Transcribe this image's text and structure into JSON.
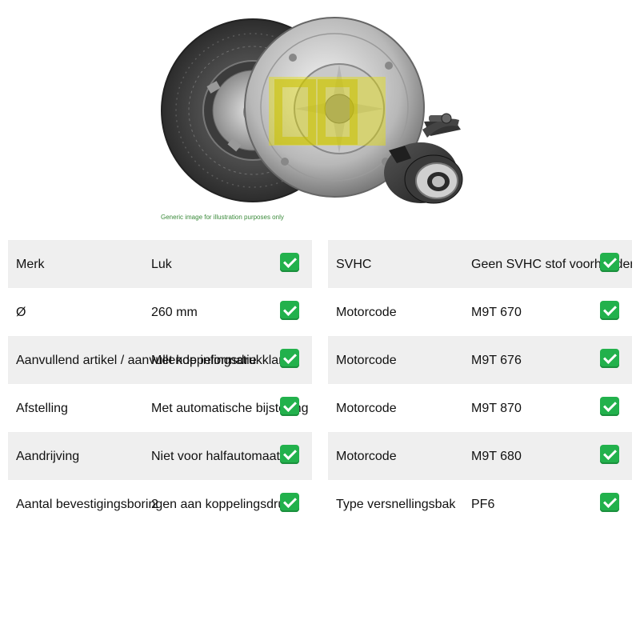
{
  "product_image": {
    "icon": "clutch-kit-photo",
    "brand_mark": "LUK",
    "caption": "Generic image for illustration purposes only"
  },
  "left_table": {
    "rows": [
      {
        "label": "Merk",
        "value": "Luk",
        "status_icon": "check-icon"
      },
      {
        "label": "Ø",
        "value": "260 mm",
        "status_icon": "check-icon"
      },
      {
        "label": "Aanvullend artikel / aanvullende informatie",
        "value": "Met koppelingsdrukklar",
        "status_icon": "check-icon"
      },
      {
        "label": "Afstelling",
        "value": "Met automatische bijstelling",
        "status_icon": "check-icon"
      },
      {
        "label": "Aandrijving",
        "value": "Niet voor halfautomaat",
        "status_icon": "check-icon"
      },
      {
        "label": "Aantal bevestigingsboringen aan koppelingsdruk",
        "value": "2",
        "status_icon": "check-icon"
      }
    ]
  },
  "right_table": {
    "rows": [
      {
        "label": "SVHC",
        "value": "Geen SVHC stof voorhanden",
        "status_icon": "check-icon"
      },
      {
        "label": "Motorcode",
        "value": "M9T 670",
        "status_icon": "check-icon"
      },
      {
        "label": "Motorcode",
        "value": "M9T 676",
        "status_icon": "check-icon"
      },
      {
        "label": "Motorcode",
        "value": "M9T 870",
        "status_icon": "check-icon"
      },
      {
        "label": "Motorcode",
        "value": "M9T 680",
        "status_icon": "check-icon"
      },
      {
        "label": "Type versnellingsbak",
        "value": "PF6",
        "status_icon": "check-icon"
      }
    ]
  },
  "colors": {
    "row_shade": "#efefef",
    "check_green": "#22b14c",
    "brand_yellow": "#e8e000"
  }
}
